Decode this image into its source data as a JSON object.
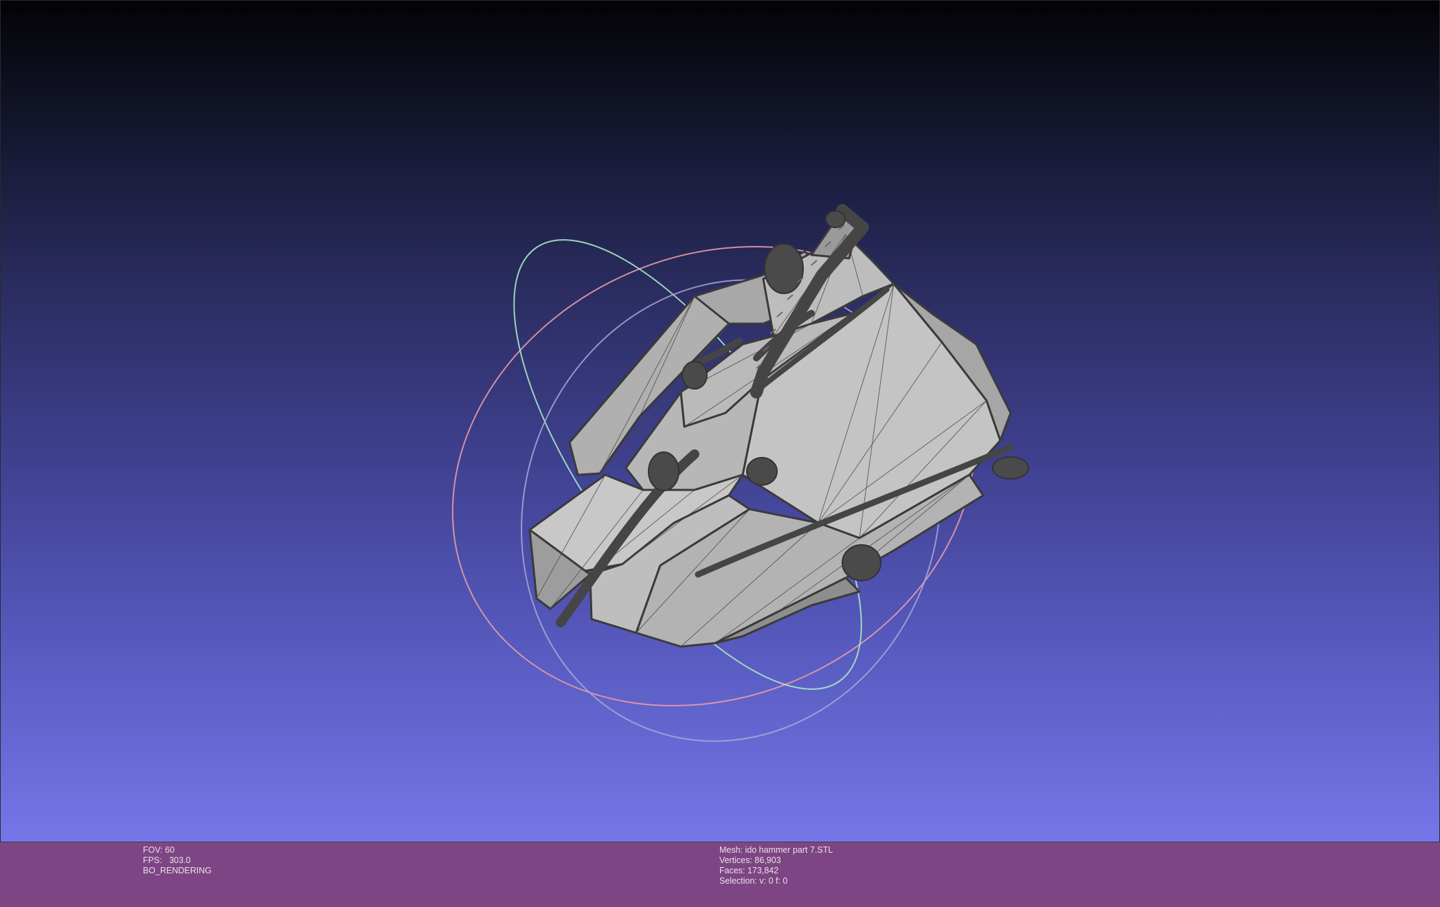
{
  "viewer": {
    "status_left": {
      "fov": "FOV: 60",
      "fps": "FPS:   303.0",
      "mode": "BO_RENDERING"
    },
    "status_right": {
      "mesh": "Mesh: ido hammer part 7.STL",
      "vertices": "Vertices: 86,903",
      "faces": "Faces: 173,842",
      "selection": "Selection: v: 0 f: 0"
    },
    "colors": {
      "background_top": "#030305",
      "background_bottom": "#7577e8",
      "info_bar": "#7d4583",
      "mesh_fill": "#b4b4b4",
      "mesh_edges": "#3c3c3c",
      "trackball_x": "#e89aa8",
      "trackball_y": "#a8e8c4",
      "trackball_z": "#b8b6e0"
    }
  }
}
